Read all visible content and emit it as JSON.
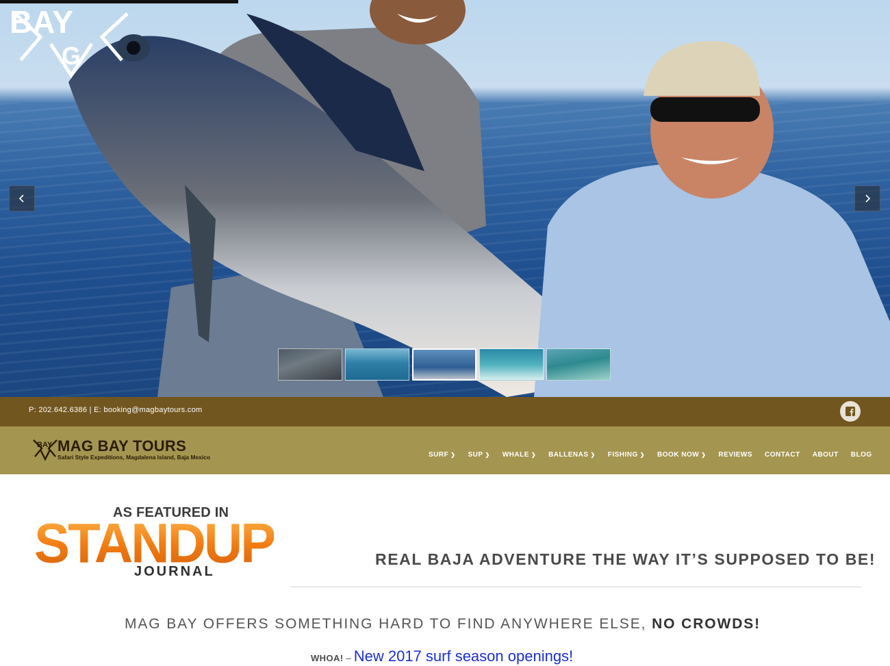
{
  "hero": {
    "logo_text": "BAYG",
    "prev_label": "previous slide",
    "next_label": "next slide",
    "thumbnails": [
      "whale",
      "surf-wave",
      "marlin-catch",
      "surf-rider",
      "surf-break"
    ],
    "active_thumbnail": 2
  },
  "infobar": {
    "contact": "P: 202.642.6386 | E: booking@magbaytours.com",
    "social": "facebook-icon"
  },
  "brand": {
    "name": "MAG BAY TOURS",
    "tagline": "Safari Style Expeditions, Magdalena Island, Baja Mexico"
  },
  "nav": {
    "items": [
      {
        "label": "SURF",
        "dropdown": true
      },
      {
        "label": "SUP",
        "dropdown": true
      },
      {
        "label": "WHALE",
        "dropdown": true
      },
      {
        "label": "BALLENAS",
        "dropdown": true
      },
      {
        "label": "FISHING",
        "dropdown": true
      },
      {
        "label": "BOOK NOW",
        "dropdown": true
      },
      {
        "label": "REVIEWS",
        "dropdown": false
      },
      {
        "label": "CONTACT",
        "dropdown": false
      },
      {
        "label": "ABOUT",
        "dropdown": false
      },
      {
        "label": "BLOG",
        "dropdown": false
      }
    ]
  },
  "featured": {
    "as_featured": "AS FEATURED IN",
    "magazine": "STANDUP",
    "journal": "JOURNAL"
  },
  "content": {
    "headline": "REAL BAJA ADVENTURE  THE WAY IT’S SUPPOSED TO BE!",
    "subhead_pre": "MAG BAY OFFERS SOMETHING HARD TO FIND ANYWHERE ELSE, ",
    "subhead_bold": "NO CROWDS!",
    "promo_label": "WHOA!",
    "promo_dash": "–",
    "promo_link": "New 2017 surf season openings!"
  },
  "colors": {
    "infobar": "#72561f",
    "navbar": "#a49550",
    "link": "#1a2fd6",
    "accent_orange": "#f08a1c"
  }
}
